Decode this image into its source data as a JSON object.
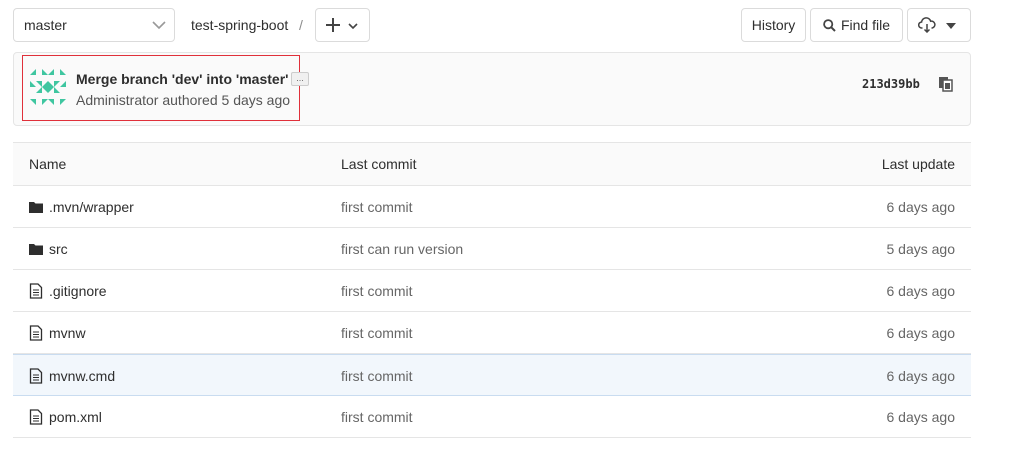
{
  "toolbar": {
    "branch": "master",
    "breadcrumb_project": "test-spring-boot",
    "breadcrumb_separator": "/",
    "history_label": "History",
    "find_file_label": "Find file"
  },
  "commit": {
    "title": "Merge branch 'dev' into 'master'",
    "ellipsis": "...",
    "meta": "Administrator authored 5 days ago",
    "sha": "213d39bb"
  },
  "table": {
    "headers": {
      "name": "Name",
      "last_commit": "Last commit",
      "last_update": "Last update"
    },
    "rows": [
      {
        "name": ".mvn/wrapper",
        "type": "folder",
        "commit": "first commit",
        "updated": "6 days ago"
      },
      {
        "name": "src",
        "type": "folder",
        "commit": "first can run version",
        "updated": "5 days ago"
      },
      {
        "name": ".gitignore",
        "type": "file",
        "commit": "first commit",
        "updated": "6 days ago"
      },
      {
        "name": "mvnw",
        "type": "file",
        "commit": "first commit",
        "updated": "6 days ago"
      },
      {
        "name": "mvnw.cmd",
        "type": "file",
        "commit": "first commit",
        "updated": "6 days ago"
      },
      {
        "name": "pom.xml",
        "type": "file",
        "commit": "first commit",
        "updated": "6 days ago"
      }
    ]
  },
  "colors": {
    "avatar": "#3fc6a0",
    "highlight": "#e0303a",
    "active_row": "#f2f7fc"
  }
}
